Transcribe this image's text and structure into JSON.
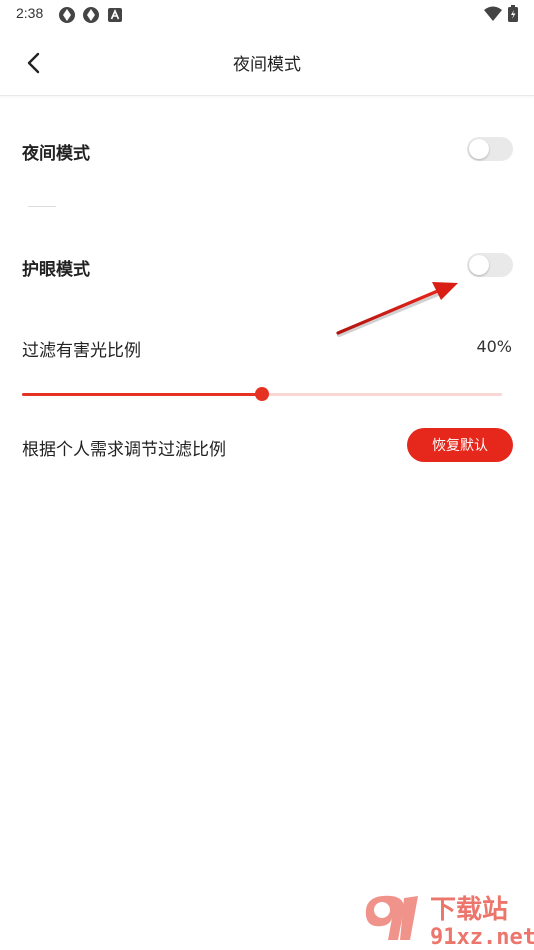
{
  "status_bar": {
    "time": "2:38"
  },
  "header": {
    "title": "夜间模式"
  },
  "settings": {
    "night_mode_label": "夜间模式",
    "night_mode_on": false,
    "eye_care_label": "护眼模式",
    "eye_care_on": false,
    "filter_label": "过滤有害光比例",
    "filter_value_text": "40%",
    "filter_level": 0.5,
    "hint_text": "根据个人需求调节过滤比例",
    "restore_label": "恢复默认"
  },
  "watermark": {
    "site_text": "91xz.net",
    "brand_text": "下载站"
  },
  "colors": {
    "accent": "#e5271c",
    "slider_track": "#f8d6d3",
    "toggle_off": "#e9e9e9"
  }
}
